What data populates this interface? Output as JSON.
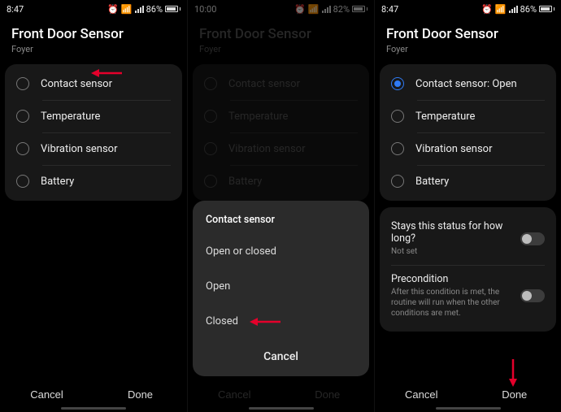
{
  "screens": [
    {
      "status": {
        "time": "8:47",
        "battery": "86%"
      },
      "header": {
        "title": "Front Door Sensor",
        "subtitle": "Foyer"
      },
      "options": [
        {
          "label": "Contact sensor",
          "selected": false
        },
        {
          "label": "Temperature",
          "selected": false
        },
        {
          "label": "Vibration sensor",
          "selected": false
        },
        {
          "label": "Battery",
          "selected": false
        }
      ],
      "footer": {
        "cancel": "Cancel",
        "done": "Done"
      }
    },
    {
      "status": {
        "time": "10:00",
        "battery": "82%"
      },
      "header": {
        "title": "Front Door Sensor",
        "subtitle": "Foyer"
      },
      "options": [
        {
          "label": "Contact sensor",
          "selected": false
        },
        {
          "label": "Temperature",
          "selected": false
        },
        {
          "label": "Vibration sensor",
          "selected": false
        },
        {
          "label": "Battery",
          "selected": false
        }
      ],
      "sheet": {
        "title": "Contact sensor",
        "items": [
          "Open or closed",
          "Open",
          "Closed"
        ],
        "cancel": "Cancel"
      },
      "footer": {
        "cancel": "Cancel",
        "done": "Done"
      }
    },
    {
      "status": {
        "time": "8:47",
        "battery": "86%"
      },
      "header": {
        "title": "Front Door Sensor",
        "subtitle": "Foyer"
      },
      "options": [
        {
          "label": "Contact sensor: Open",
          "selected": true
        },
        {
          "label": "Temperature",
          "selected": false
        },
        {
          "label": "Vibration sensor",
          "selected": false
        },
        {
          "label": "Battery",
          "selected": false
        }
      ],
      "settings": [
        {
          "title": "Stays this status for how long?",
          "subtitle": "Not set",
          "on": false
        },
        {
          "title": "Precondition",
          "subtitle": "After this condition is met, the routine will run when the other conditions are met.",
          "on": false
        }
      ],
      "footer": {
        "cancel": "Cancel",
        "done": "Done"
      }
    }
  ]
}
